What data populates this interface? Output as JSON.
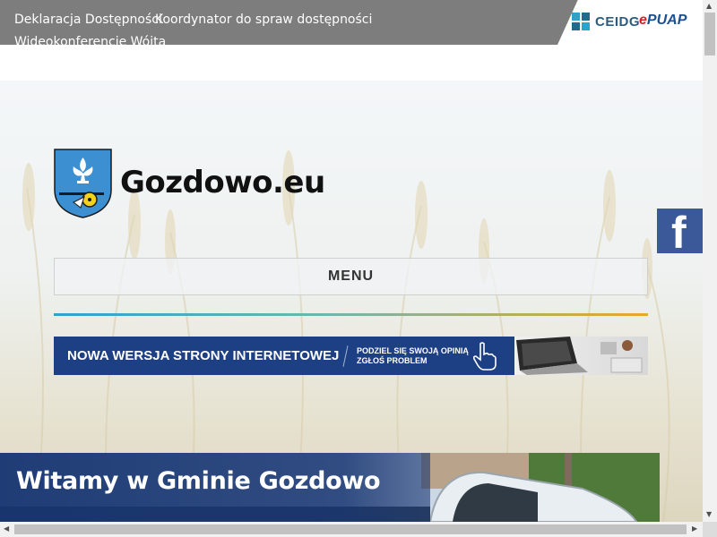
{
  "topbar": {
    "links": [
      "Deklaracja Dostępności",
      "Koordynator do spraw dostępności",
      "Wideokonferencje Wójta"
    ],
    "ceidg_label": "CEIDG",
    "epuap_prefix": "e",
    "epuap_label": "PUAP"
  },
  "header": {
    "site_title": "Gozdowo.eu",
    "facebook_glyph": "f",
    "menu_label": "MENU"
  },
  "banner": {
    "headline": "NOWA WERSJA STRONY INTERNETOWEJ",
    "line1": "PODZIEL SIĘ SWOJĄ OPINIĄ",
    "line2": "ZGŁOŚ PROBLEM"
  },
  "hero": {
    "title": "Witamy w Gminie Gozdowo"
  },
  "colors": {
    "topbar": "#7d7d7d",
    "banner_blue": "#1d3f83",
    "facebook": "#3b5998",
    "divider_start": "#2ea3c9",
    "divider_end": "#e6a928"
  },
  "icons": [
    "ceidg-logo-icon",
    "epuap-logo-icon",
    "coat-of-arms-icon",
    "facebook-icon",
    "pointing-hand-icon"
  ]
}
